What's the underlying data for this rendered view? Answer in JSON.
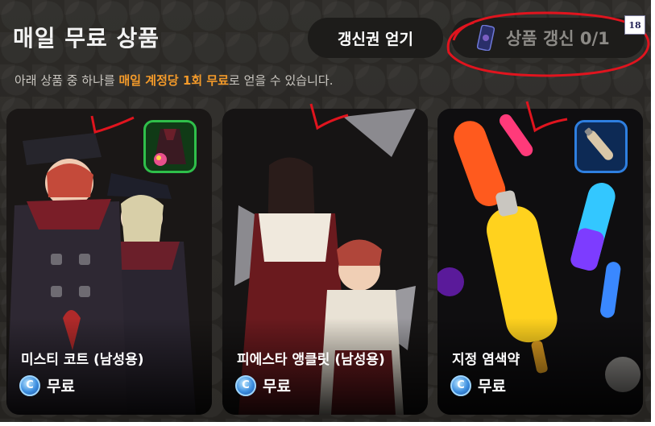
{
  "header": {
    "title": "매일 무료 상품",
    "get_ticket_label": "갱신권 얻기",
    "refresh_label": "상품 갱신 0/1",
    "age_rating": "18"
  },
  "subtitle": {
    "prefix": "아래 상품 중 하나를 ",
    "highlight": "매일 계정당 1회 무료",
    "suffix": "로 얻을 수 있습니다."
  },
  "products": [
    {
      "name": "미스티 코트 (남성용)",
      "price": "무료",
      "thumb_icon": "coat-icon"
    },
    {
      "name": "피에스타 앵클릿 (남성용)",
      "price": "무료",
      "thumb_icon": null
    },
    {
      "name": "지정 염색약",
      "price": "무료",
      "thumb_icon": "dye-vial-icon"
    }
  ],
  "currency_icon_letter": "C",
  "colors": {
    "highlight": "#f39a2a",
    "rare_border": "#2fbf4a",
    "epic_border": "#2e7fe0",
    "annotation": "#e0141e"
  }
}
